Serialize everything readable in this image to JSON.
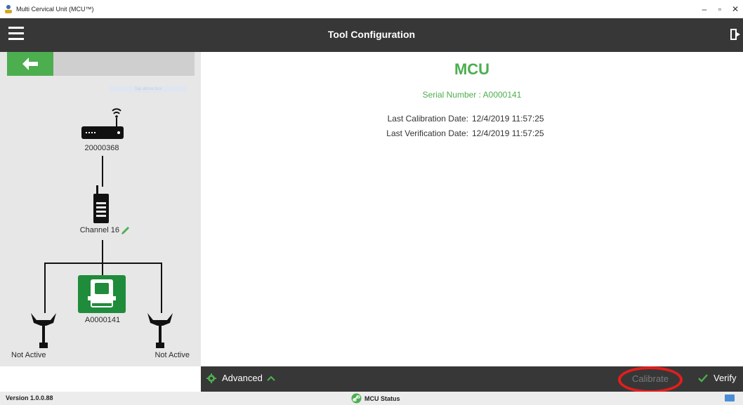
{
  "window": {
    "title": "Multi Cervical Unit (MCU™)"
  },
  "header": {
    "title": "Tool Configuration"
  },
  "left": {
    "hint_text": "Tap above box",
    "router_id": "20000368",
    "channel_label": "Channel 16",
    "mcu_id": "A0000141",
    "left_sensor_status": "Not Active",
    "right_sensor_status": "Not Active"
  },
  "main": {
    "title": "MCU",
    "serial_label": "Serial Number :",
    "serial_value": "A0000141",
    "calibration_label": "Last Calibration Date:",
    "calibration_value": "12/4/2019 11:57:25",
    "verification_label": "Last Verification Date:",
    "verification_value": "12/4/2019 11:57:25"
  },
  "toolbar": {
    "advanced_label": "Advanced",
    "calibrate_label": "Calibrate",
    "verify_label": "Verify"
  },
  "status": {
    "version": "Version 1.0.0.88",
    "mcu_status": "MCU Status"
  },
  "colors": {
    "accent": "#4cae4f",
    "header_bg": "#373737",
    "highlight": "#e41d1d"
  },
  "icons": {
    "menu": "hamburger-icon",
    "exit": "exit-icon",
    "back": "arrow-left-icon",
    "router": "wifi-router-icon",
    "radio": "radio-icon",
    "edit": "pencil-icon",
    "mcu": "mcu-unit-icon",
    "sensor": "sensor-icon",
    "gear": "gear-icon",
    "chevron": "chevron-up-icon",
    "check": "check-icon",
    "link": "link-icon",
    "keyboard": "keyboard-icon"
  }
}
